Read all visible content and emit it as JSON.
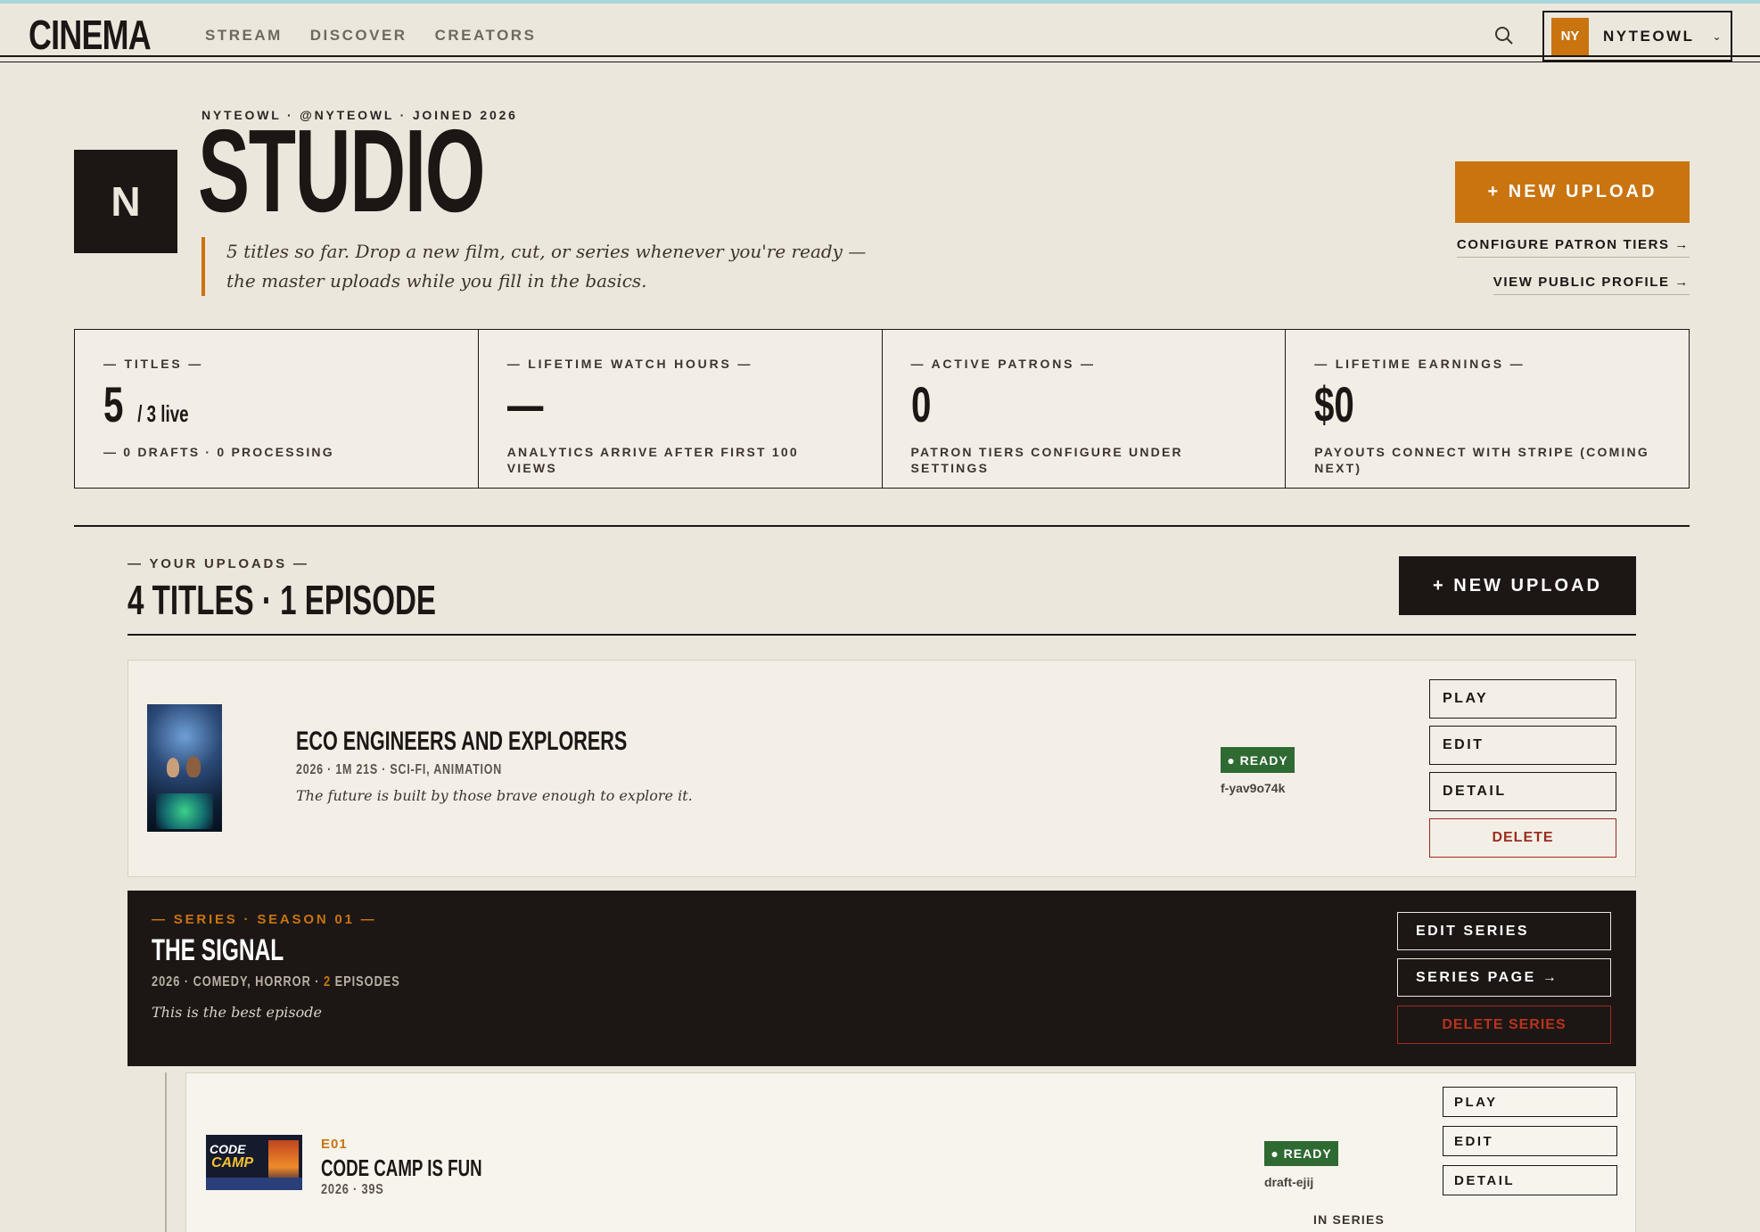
{
  "nav": {
    "logo": "CINEMA",
    "links": [
      "STREAM",
      "DISCOVER",
      "CREATORS"
    ],
    "user_initials": "NY",
    "user_name": "NYTEOWL",
    "colors": {
      "accent": "#c9740f",
      "ink": "#1c1714",
      "paper": "#ece7dd"
    }
  },
  "header": {
    "monogram": "N",
    "meta": "NYTEOWL · @NYTEOWL · JOINED 2026",
    "title": "STUDIO",
    "intro": "5 titles so far. Drop a new film, cut, or series whenever you're ready — the master uploads while you fill in the basics.",
    "new_upload": "+  NEW UPLOAD",
    "configure_tiers": "CONFIGURE PATRON TIERS →",
    "view_profile": "VIEW PUBLIC PROFILE →"
  },
  "stats": [
    {
      "label": "— TITLES —",
      "value": "5",
      "sub": "/ 3 live",
      "note": "— 0 DRAFTS · 0 PROCESSING"
    },
    {
      "label": "— LIFETIME WATCH HOURS —",
      "value": "—",
      "sub": "",
      "note": "ANALYTICS ARRIVE AFTER FIRST 100 VIEWS"
    },
    {
      "label": "— ACTIVE PATRONS —",
      "value": "0",
      "sub": "",
      "note": "PATRON TIERS CONFIGURE UNDER SETTINGS"
    },
    {
      "label": "— LIFETIME EARNINGS —",
      "value": "$0",
      "sub": "",
      "note": "PAYOUTS CONNECT WITH STRIPE (COMING NEXT)"
    }
  ],
  "uploads": {
    "eyebrow": "— YOUR UPLOADS —",
    "title": "4 TITLES · 1 EPISODE",
    "new_upload": "+ NEW UPLOAD"
  },
  "film": {
    "title": "ECO ENGINEERS AND EXPLORERS",
    "meta": "2026  · 1M 21S  · SCI-FI, ANIMATION",
    "description": "The future is built by those brave enough to explore it.",
    "status": "● READY",
    "code": "f-yav9o74k",
    "actions": {
      "play": "PLAY",
      "edit": "EDIT",
      "detail": "DETAIL",
      "delete": "DELETE"
    }
  },
  "series": {
    "eyebrow": "— SERIES · SEASON 01 —",
    "title": "THE SIGNAL",
    "meta_prefix": "2026  · COMEDY, HORROR  · ",
    "episodes_count": "2",
    "episodes_label": " EPISODES",
    "description": "This is the best episode",
    "actions": {
      "edit": "EDIT SERIES",
      "page": "SERIES PAGE →",
      "delete": "DELETE SERIES"
    }
  },
  "episode": {
    "thumb_line1": "CODE",
    "thumb_line2": "CAMP",
    "number": "E01",
    "title": "CODE CAMP IS FUN",
    "meta": "2026  · 39S",
    "status": "● READY",
    "code": "draft-ejij",
    "actions": {
      "play": "PLAY",
      "edit": "EDIT",
      "detail": "DETAIL"
    },
    "in_series": "IN SERIES"
  }
}
